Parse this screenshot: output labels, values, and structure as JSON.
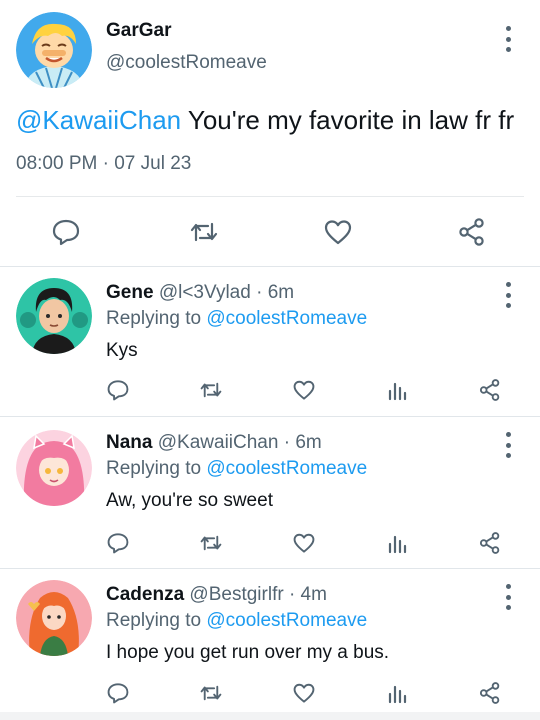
{
  "main_tweet": {
    "display_name": "GarGar",
    "handle": "@coolestRomeave",
    "text_mention": "@KawaiiChan",
    "text_body": " You're my favorite in law fr fr",
    "timestamp": "08:00 PM · 07 Jul 23",
    "actions": [
      "reply-icon",
      "retweet-icon",
      "like-icon",
      "share-icon"
    ]
  },
  "replies": [
    {
      "display_name": "Gene",
      "handle": "@l<3Vylad · 6m",
      "replying_prefix": "Replying to ",
      "replying_to": "@coolestRomeave",
      "text": "Kys",
      "avatar_bg": "#2ec4a6"
    },
    {
      "display_name": "Nana",
      "handle": "@KawaiiChan · 6m",
      "replying_prefix": "Replying to ",
      "replying_to": "@coolestRomeave",
      "text": "Aw, you're so sweet",
      "avatar_bg": "#f9b8cf"
    },
    {
      "display_name": "Cadenza",
      "handle": "@Bestgirlfr · 4m",
      "replying_prefix": "Replying to ",
      "replying_to": "@coolestRomeave",
      "text": "I hope you get run over my a bus.",
      "avatar_bg": "#f7a8b0"
    }
  ],
  "colors": {
    "accent": "#1d9bf0",
    "text": "#0f1419",
    "muted": "#536471",
    "divider": "#e6e9eb"
  }
}
